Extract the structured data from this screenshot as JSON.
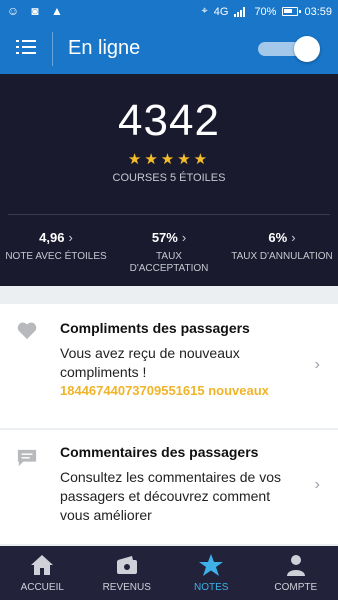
{
  "status_bar": {
    "network": "4G",
    "battery": "70%",
    "time": "03:59"
  },
  "app_bar": {
    "title": "En ligne",
    "online_toggle_on": true
  },
  "stats": {
    "five_star_trips": "4342",
    "stars": "★★★★★",
    "five_star_label": "COURSES 5 ÉTOILES",
    "metrics": [
      {
        "value": "4,96",
        "label": "NOTE AVEC ÉTOILES"
      },
      {
        "value": "57%",
        "label": "TAUX D'ACCEPTATION"
      },
      {
        "value": "6%",
        "label": "TAUX D'ANNULATION"
      }
    ]
  },
  "cards": {
    "compliments": {
      "icon": "heart-icon",
      "title": "Compliments des passagers",
      "body": "Vous avez reçu de nouveaux compliments !",
      "highlight": "18446744073709551615 nouveaux"
    },
    "comments": {
      "icon": "chat-icon",
      "title": "Commentaires des passagers",
      "body": "Consultez les commentaires de vos passagers et découvrez comment vous améliorer"
    }
  },
  "bottom_nav": {
    "items": [
      {
        "label": "ACCUEIL",
        "icon": "home-icon"
      },
      {
        "label": "REVENUS",
        "icon": "wallet-icon"
      },
      {
        "label": "NOTES",
        "icon": "star-icon",
        "active": true
      },
      {
        "label": "COMPTE",
        "icon": "person-icon"
      }
    ]
  },
  "colors": {
    "primary": "#1976c9",
    "dark_panel": "#1a1a2e",
    "star": "#f6bd2b",
    "highlight": "#f0b429",
    "active_tab": "#3eb1e8"
  }
}
